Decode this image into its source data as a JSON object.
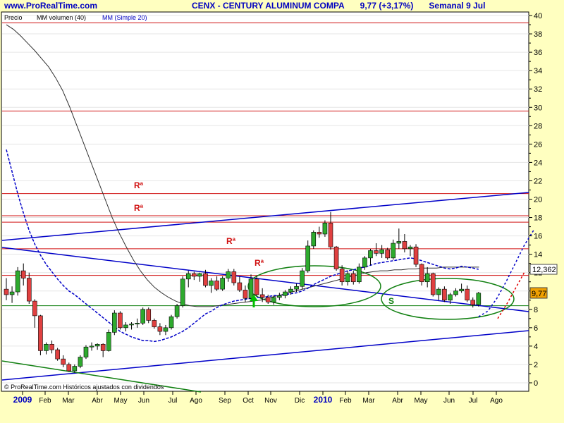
{
  "header": {
    "site": "www.ProRealTime.com",
    "symbol": "CENX - CENTURY ALUMINUM COMPA",
    "price_change": "9,77 (+3,17%)",
    "period": "Semanal 9 Jul"
  },
  "legend": {
    "price": "Precio",
    "vol": "MM volumen (40)",
    "ma": "MM (Simple 20)"
  },
  "footer": "© ProRealTime.com Históricos ajustados con dividendos",
  "annotations": {
    "r1": "Rª",
    "r2": "Rª",
    "r3": "Rª",
    "r4": "Rª",
    "s": "S"
  },
  "price_tags": {
    "upper": "12,362",
    "last": "9,77"
  },
  "colors": {
    "background": "#ffffc0",
    "up": "#2eaa2e",
    "down": "#e04040",
    "trendline": "#0000c8",
    "resistance": "#d01010",
    "ellipse": "#118011"
  },
  "chart_data": {
    "type": "candlestick",
    "x_axis_labels": [
      "2009",
      "Feb",
      "Mar",
      "Abr",
      "May",
      "Jun",
      "Jul",
      "Ago",
      "Sep",
      "Oct",
      "Nov",
      "Dic",
      "2010",
      "Feb",
      "Mar",
      "Abr",
      "May",
      "Jun",
      "Jul",
      "Ago"
    ],
    "y_ticks": [
      0,
      2,
      4,
      6,
      8,
      10,
      12,
      14,
      16,
      18,
      20,
      22,
      24,
      26,
      28,
      30,
      32,
      34,
      36,
      38,
      40
    ],
    "ylim": [
      -0.5,
      40.5
    ],
    "series": [
      {
        "name": "Precio",
        "type": "candlestick",
        "values": [
          [
            10.2,
            11.4,
            9.0,
            9.6
          ],
          [
            9.6,
            10.5,
            8.7,
            9.9
          ],
          [
            9.9,
            12.6,
            9.5,
            12.2
          ],
          [
            12.2,
            13.0,
            10.6,
            11.4
          ],
          [
            11.4,
            12.0,
            8.6,
            8.9
          ],
          [
            8.9,
            9.1,
            6.0,
            7.3
          ],
          [
            7.3,
            7.4,
            3.0,
            3.5
          ],
          [
            3.5,
            4.4,
            3.1,
            4.2
          ],
          [
            4.2,
            4.6,
            3.2,
            3.6
          ],
          [
            3.6,
            3.8,
            2.4,
            2.6
          ],
          [
            2.6,
            3.0,
            1.7,
            2.0
          ],
          [
            2.0,
            2.2,
            1.2,
            1.3
          ],
          [
            1.3,
            2.0,
            1.1,
            1.8
          ],
          [
            1.8,
            3.0,
            1.6,
            2.8
          ],
          [
            2.8,
            4.1,
            2.6,
            3.9
          ],
          [
            3.9,
            4.4,
            3.5,
            4.0
          ],
          [
            4.0,
            4.3,
            3.6,
            4.2
          ],
          [
            4.2,
            4.3,
            2.8,
            3.5
          ],
          [
            3.5,
            5.8,
            3.4,
            5.5
          ],
          [
            5.5,
            7.9,
            5.2,
            7.6
          ],
          [
            7.6,
            7.8,
            5.8,
            6.0
          ],
          [
            6.0,
            6.6,
            5.6,
            6.3
          ],
          [
            6.3,
            6.6,
            5.8,
            6.4
          ],
          [
            6.4,
            7.0,
            6.0,
            6.5
          ],
          [
            6.5,
            8.2,
            6.3,
            8.0
          ],
          [
            8.0,
            8.2,
            6.5,
            6.8
          ],
          [
            6.8,
            7.0,
            5.9,
            6.1
          ],
          [
            6.1,
            6.5,
            5.2,
            5.6
          ],
          [
            5.6,
            6.3,
            5.2,
            6.0
          ],
          [
            6.0,
            7.4,
            5.8,
            7.2
          ],
          [
            7.2,
            8.6,
            7.0,
            8.4
          ],
          [
            8.4,
            11.6,
            8.2,
            11.3
          ],
          [
            11.3,
            12.2,
            10.4,
            11.9
          ],
          [
            11.9,
            12.1,
            11.2,
            11.6
          ],
          [
            11.6,
            12.0,
            11.0,
            11.9
          ],
          [
            11.9,
            12.3,
            10.4,
            10.6
          ],
          [
            10.6,
            11.4,
            9.8,
            11.1
          ],
          [
            11.1,
            11.6,
            10.0,
            10.2
          ],
          [
            10.2,
            11.6,
            10.0,
            11.4
          ],
          [
            11.4,
            12.4,
            11.0,
            12.1
          ],
          [
            12.1,
            12.4,
            10.6,
            10.9
          ],
          [
            10.9,
            11.6,
            9.9,
            10.1
          ],
          [
            10.1,
            10.6,
            8.8,
            9.2
          ],
          [
            9.2,
            11.8,
            9.0,
            11.3
          ],
          [
            11.3,
            11.6,
            9.4,
            9.6
          ],
          [
            9.6,
            10.3,
            8.8,
            9.3
          ],
          [
            9.3,
            9.6,
            8.6,
            8.8
          ],
          [
            8.8,
            9.5,
            8.5,
            9.3
          ],
          [
            9.3,
            9.8,
            9.0,
            9.5
          ],
          [
            9.5,
            10.1,
            9.2,
            9.9
          ],
          [
            9.9,
            10.5,
            9.6,
            10.2
          ],
          [
            10.2,
            10.8,
            9.9,
            10.5
          ],
          [
            10.5,
            12.5,
            10.2,
            12.2
          ],
          [
            12.2,
            15.5,
            12.0,
            14.9
          ],
          [
            14.9,
            16.6,
            14.6,
            16.4
          ],
          [
            16.4,
            17.0,
            15.8,
            16.2
          ],
          [
            16.2,
            17.7,
            15.9,
            17.4
          ],
          [
            17.4,
            18.6,
            14.5,
            14.8
          ],
          [
            14.8,
            14.9,
            12.2,
            12.4
          ],
          [
            12.4,
            12.8,
            10.6,
            11.0
          ],
          [
            11.0,
            12.2,
            10.6,
            11.9
          ],
          [
            11.9,
            12.2,
            10.7,
            11.0
          ],
          [
            11.0,
            13.0,
            10.8,
            12.6
          ],
          [
            12.6,
            13.8,
            12.3,
            13.6
          ],
          [
            13.6,
            14.6,
            12.8,
            14.4
          ],
          [
            14.4,
            15.2,
            13.8,
            14.1
          ],
          [
            14.1,
            15.0,
            13.6,
            14.5
          ],
          [
            14.5,
            14.7,
            13.4,
            13.6
          ],
          [
            13.6,
            15.6,
            13.4,
            15.2
          ],
          [
            15.2,
            16.8,
            14.6,
            15.4
          ],
          [
            15.4,
            16.2,
            14.2,
            14.6
          ],
          [
            14.6,
            15.0,
            13.8,
            14.8
          ],
          [
            14.8,
            15.1,
            12.6,
            12.9
          ],
          [
            12.9,
            13.0,
            10.6,
            11.0
          ],
          [
            11.0,
            12.6,
            10.4,
            11.9
          ],
          [
            11.9,
            12.0,
            9.4,
            9.6
          ],
          [
            9.6,
            10.4,
            9.0,
            10.2
          ],
          [
            10.2,
            10.5,
            8.8,
            9.0
          ],
          [
            9.0,
            9.8,
            8.6,
            9.6
          ],
          [
            9.6,
            10.3,
            9.4,
            10.0
          ],
          [
            10.0,
            10.8,
            9.8,
            10.2
          ],
          [
            10.2,
            10.6,
            8.8,
            9.0
          ],
          [
            9.0,
            9.3,
            8.2,
            8.5
          ],
          [
            8.5,
            9.9,
            8.3,
            9.77
          ]
        ]
      },
      {
        "name": "MM (Simple 20)",
        "type": "line",
        "values": [
          25.4,
          23.0,
          20.6,
          18.5,
          16.6,
          15.1,
          13.9,
          12.9,
          12.1,
          11.3,
          10.6,
          10.0,
          9.6,
          9.1,
          8.6,
          8.1,
          7.6,
          7.1,
          6.6,
          6.1,
          5.6,
          5.3,
          5.0,
          4.8,
          4.6,
          4.6,
          4.5,
          4.6,
          4.8,
          5.0,
          5.3,
          5.6,
          6.0,
          6.5,
          7.0,
          7.5,
          7.8,
          8.2,
          8.5,
          8.7,
          8.9,
          9.0,
          9.1,
          9.2,
          9.3,
          9.3,
          9.4,
          9.5,
          9.5,
          9.6,
          9.7,
          9.8,
          10.0,
          10.3,
          10.7,
          11.0,
          11.3,
          11.6,
          11.8,
          12.0,
          12.2,
          12.3,
          12.5,
          12.6,
          12.8,
          13.0,
          13.1,
          13.2,
          13.3,
          13.4,
          13.5,
          13.6,
          13.5,
          13.3,
          13.1,
          12.9,
          12.7,
          12.5,
          12.4,
          12.5,
          12.7,
          12.6,
          12.5,
          12.362
        ]
      },
      {
        "name": "MM volumen (40)",
        "type": "line",
        "values": [
          39.0,
          38.5,
          37.8,
          37.0,
          36.2,
          35.3,
          34.4,
          33.2,
          31.8,
          30.0,
          28.0,
          26.0,
          24.0,
          22.0,
          20.0,
          18.0,
          16.3,
          14.8,
          13.4,
          12.2,
          11.2,
          10.4,
          9.8,
          9.3,
          8.9,
          8.6,
          8.4,
          8.3,
          8.3,
          8.3,
          8.4,
          8.5,
          8.6,
          8.7,
          8.8,
          8.9,
          9.0,
          9.2,
          9.4,
          9.6,
          9.8,
          10.0,
          10.2,
          10.4,
          10.6,
          10.8,
          11.0,
          11.2,
          11.4,
          11.6,
          11.8,
          12.0,
          12.1,
          12.2,
          12.2,
          12.3,
          12.3,
          12.4,
          12.4,
          12.5,
          12.5,
          12.5,
          12.6,
          12.6,
          12.6,
          12.6,
          12.6,
          12.6
        ]
      }
    ],
    "horizontal_lines": [
      39.2,
      29.6,
      20.6,
      18.2,
      17.5,
      14.6,
      11.7,
      8.4
    ],
    "projection_blue": [
      [
        0,
        7.2
      ],
      [
        1,
        7.8
      ],
      [
        2,
        9.2
      ],
      [
        3,
        11.0
      ],
      [
        4,
        13.0
      ],
      [
        5,
        15.0
      ],
      [
        6,
        16.6
      ]
    ],
    "projection_red": [
      [
        0,
        7.0
      ],
      [
        1,
        8.6
      ],
      [
        2,
        10.4
      ],
      [
        3,
        12.2
      ]
    ]
  }
}
